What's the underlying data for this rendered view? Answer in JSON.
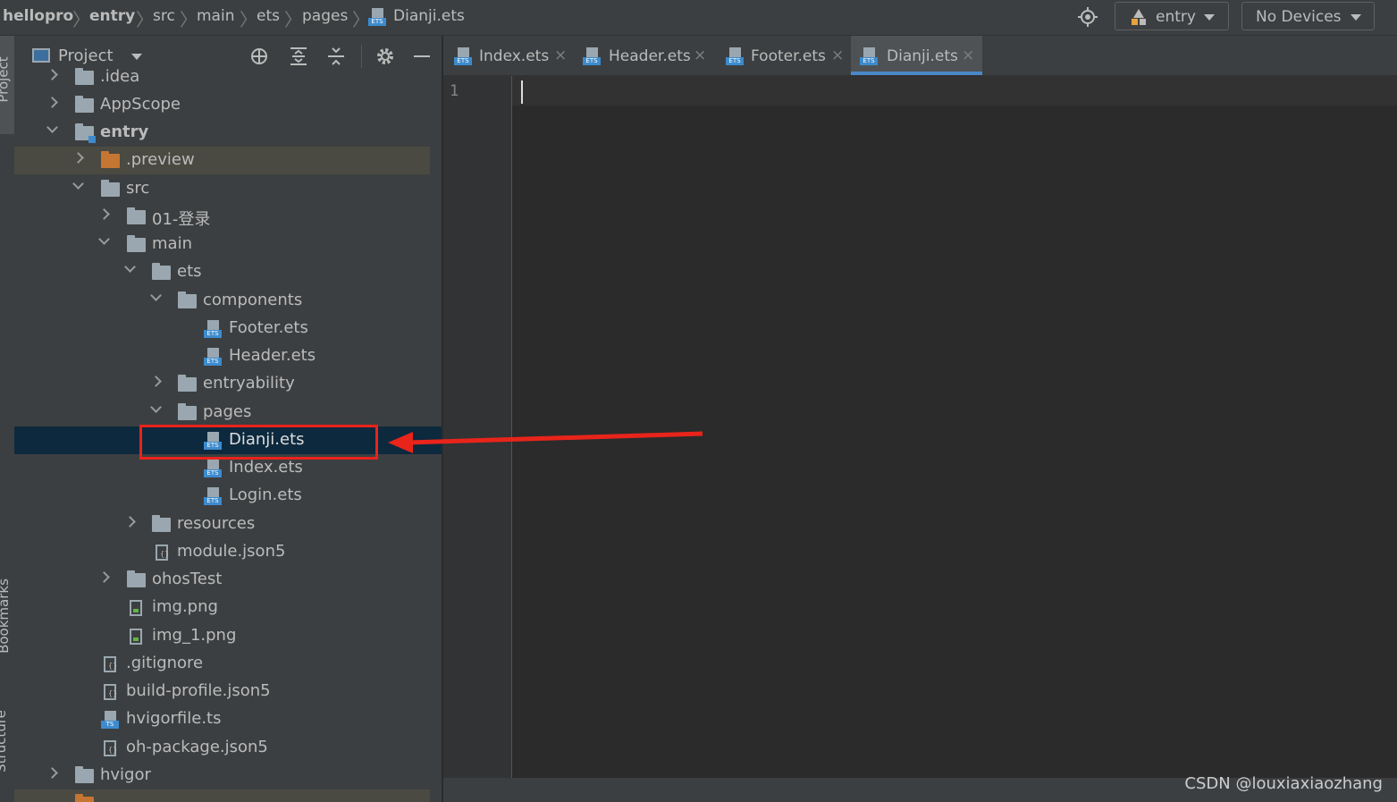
{
  "breadcrumb": {
    "items": [
      "hellopro",
      "entry",
      "src",
      "main",
      "ets",
      "pages",
      "Dianji.ets"
    ]
  },
  "toolbar": {
    "module_selector": "entry",
    "device_selector": "No Devices"
  },
  "left_strip": {
    "top_label": "Project",
    "middle_label": "Bookmarks",
    "bottom_label": "Structure"
  },
  "project_panel": {
    "title": "Project"
  },
  "tree": {
    "rows": [
      {
        "label": ".idea"
      },
      {
        "label": "AppScope"
      },
      {
        "label": "entry"
      },
      {
        "label": ".preview"
      },
      {
        "label": "src"
      },
      {
        "label": "01-登录"
      },
      {
        "label": "main"
      },
      {
        "label": "ets"
      },
      {
        "label": "components"
      },
      {
        "label": "Footer.ets"
      },
      {
        "label": "Header.ets"
      },
      {
        "label": "entryability"
      },
      {
        "label": "pages"
      },
      {
        "label": "Dianji.ets"
      },
      {
        "label": "Index.ets"
      },
      {
        "label": "Login.ets"
      },
      {
        "label": "resources"
      },
      {
        "label": "module.json5"
      },
      {
        "label": "ohosTest"
      },
      {
        "label": "img.png"
      },
      {
        "label": "img_1.png"
      },
      {
        "label": ".gitignore"
      },
      {
        "label": "build-profile.json5"
      },
      {
        "label": "hvigorfile.ts"
      },
      {
        "label": "oh-package.json5"
      },
      {
        "label": "hvigor"
      }
    ]
  },
  "tabs": [
    {
      "label": "Index.ets"
    },
    {
      "label": "Header.ets"
    },
    {
      "label": "Footer.ets"
    },
    {
      "label": "Dianji.ets",
      "active": true
    }
  ],
  "editor": {
    "line_number": "1"
  },
  "watermark": "CSDN @louxiaxiaozhang",
  "colors": {
    "highlight_box": "#e8241b",
    "selected_row": "#0d293e",
    "active_tab_underline": "#4a88c7"
  }
}
